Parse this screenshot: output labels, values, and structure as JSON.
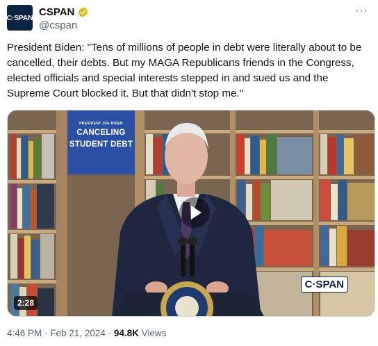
{
  "account": {
    "avatar_text": "C·SPAN",
    "display_name": "CSPAN",
    "handle": "@cspan",
    "more_label": "···"
  },
  "tweet": {
    "text": "President Biden: \"Tens of millions of people in debt were literally about to be cancelled, their debts. But my MAGA Republicans friends in the Congress, elected officials and special interests stepped in and sued us and the Supreme Court blocked it. But that didn't stop me.\""
  },
  "video": {
    "duration": "2:28",
    "banner_small": "PRESIDENT JOE BIDEN",
    "banner_big_1": "CANCELING",
    "banner_big_2": "STUDENT DEBT",
    "watermark": "C·SPAN"
  },
  "meta": {
    "time": "4:46 PM",
    "date": "Feb 21, 2024",
    "views_count": "94.8K",
    "views_label": "Views"
  },
  "colors": {
    "verified_badge": "#e2b719",
    "avatar_bg": "#0c2444",
    "secondary_text": "#536471"
  }
}
